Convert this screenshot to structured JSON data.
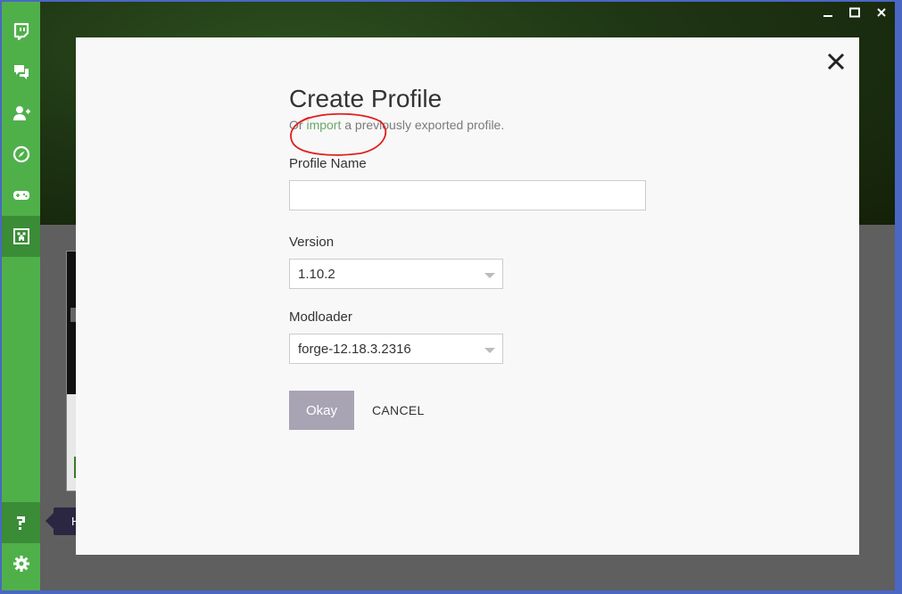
{
  "window": {
    "controls": [
      {
        "name": "minimize",
        "icon": "minimize-icon"
      },
      {
        "name": "maximize",
        "icon": "maximize-icon"
      },
      {
        "name": "close",
        "icon": "close-icon"
      }
    ]
  },
  "sidebar": {
    "items": [
      {
        "icon": "twitch-icon"
      },
      {
        "icon": "chat-icon"
      },
      {
        "icon": "add-friend-icon"
      },
      {
        "icon": "compass-icon"
      },
      {
        "icon": "gamepad-icon"
      },
      {
        "icon": "minecraft-creeper-icon",
        "active": true
      }
    ],
    "bottom": [
      {
        "icon": "help-icon",
        "active": true
      },
      {
        "icon": "gear-icon"
      }
    ],
    "accent": "#4fb04a"
  },
  "tooltip": {
    "text": "Help"
  },
  "modal": {
    "title": "Create Profile",
    "subtitle_prefix": "Or ",
    "subtitle_link": "import",
    "subtitle_suffix": " a previously exported profile.",
    "profile_name": {
      "label": "Profile Name",
      "value": "",
      "placeholder": ""
    },
    "version": {
      "label": "Version",
      "value": "1.10.2"
    },
    "modloader": {
      "label": "Modloader",
      "value": "forge-12.18.3.2316"
    },
    "okay_label": "Okay",
    "cancel_label": "CANCEL"
  },
  "colors": {
    "okay_button": "#a8a4b4",
    "link": "#6aa86a",
    "annotation": "#e02020"
  }
}
